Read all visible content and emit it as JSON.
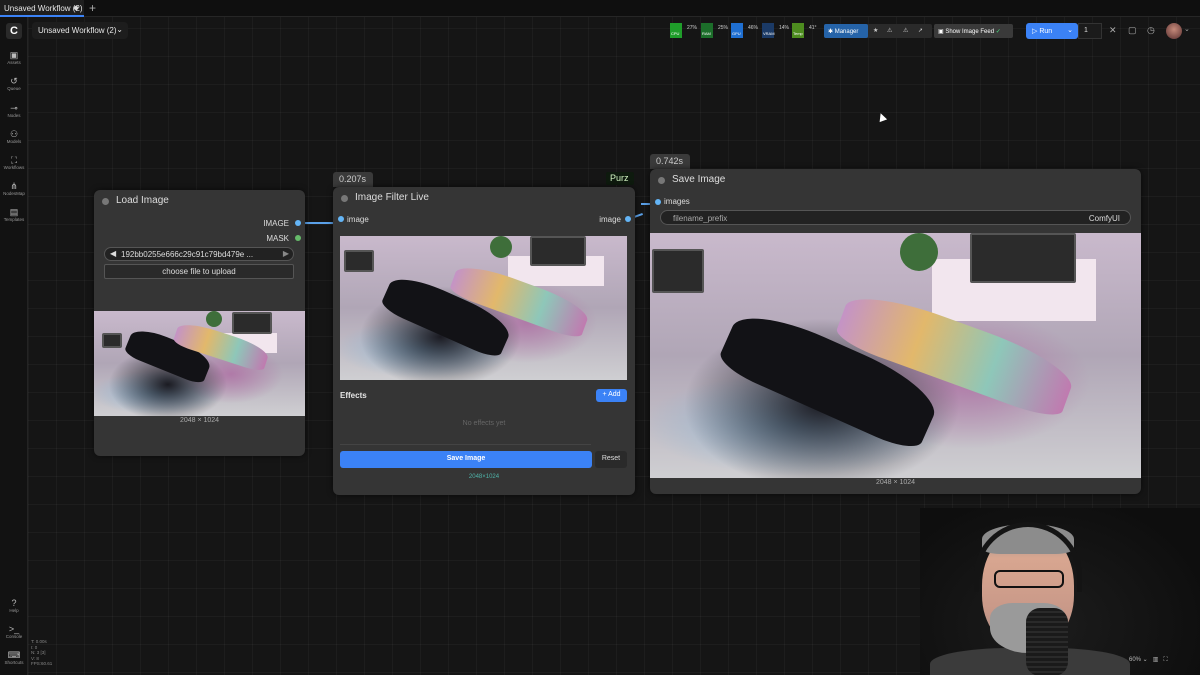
{
  "tabs": [
    {
      "label": "Unsaved Workflow (2)",
      "modified": true
    }
  ],
  "tab_add_icon": "plus-icon",
  "workflow_title": "Unsaved Workflow (2)",
  "sidebar": {
    "items": [
      {
        "label": "Assets",
        "icon": "assets-icon"
      },
      {
        "label": "Queue",
        "icon": "history-icon"
      },
      {
        "label": "Nodes",
        "icon": "nodes-icon"
      },
      {
        "label": "Models",
        "icon": "models-icon"
      },
      {
        "label": "Workflows",
        "icon": "workflows-icon"
      },
      {
        "label": "NodesMap",
        "icon": "nodesmap-icon"
      },
      {
        "label": "Templates",
        "icon": "templates-icon"
      }
    ],
    "bottom_items": [
      {
        "label": "Help",
        "icon": "help-icon"
      },
      {
        "label": "Console",
        "icon": "console-icon"
      },
      {
        "label": "Shortcuts",
        "icon": "keyboard-icon"
      }
    ]
  },
  "stats": {
    "t": "T: 0.00s",
    "i": "I: 0",
    "n": "N: 3 [3]",
    "v": "V: 8",
    "fps": "FPS:60.61"
  },
  "monitor": [
    {
      "label": "CPU",
      "value": "27%",
      "color": "#1f9d2a"
    },
    {
      "label": "RAM",
      "value": "25%",
      "color": "#1c6e2a"
    },
    {
      "label": "GPU",
      "value": "46%",
      "color": "#1f6fd1"
    },
    {
      "label": "VRAM",
      "value": "14%",
      "color": "#1b3a66"
    },
    {
      "label": "Temp",
      "value": "41°",
      "color": "#4d8c1f"
    }
  ],
  "toolbar": {
    "manager_label": "Manager",
    "show_image_feed_label": "Show Image Feed",
    "run_label": "Run",
    "queue_count": "1"
  },
  "nodes": {
    "load_image": {
      "title": "Load Image",
      "outputs": [
        "IMAGE",
        "MASK"
      ],
      "filename": "192bb0255e666c29c91c79bd479e ...",
      "upload_label": "choose file to upload",
      "dims": "2048 × 1024"
    },
    "filter": {
      "title": "Image Filter Live",
      "time": "0.207s",
      "tag": "Purz",
      "input": "image",
      "output": "image",
      "effects_label": "Effects",
      "add_label": "+ Add",
      "empty_label": "No effects yet",
      "save_label": "Save Image",
      "reset_label": "Reset",
      "dims": "2048×1024"
    },
    "save_image": {
      "title": "Save Image",
      "time": "0.742s",
      "input": "images",
      "prefix_label": "filename_prefix",
      "prefix_value": "ComfyUI",
      "dims": "2048 × 1024"
    }
  },
  "zoom_label": "60%"
}
